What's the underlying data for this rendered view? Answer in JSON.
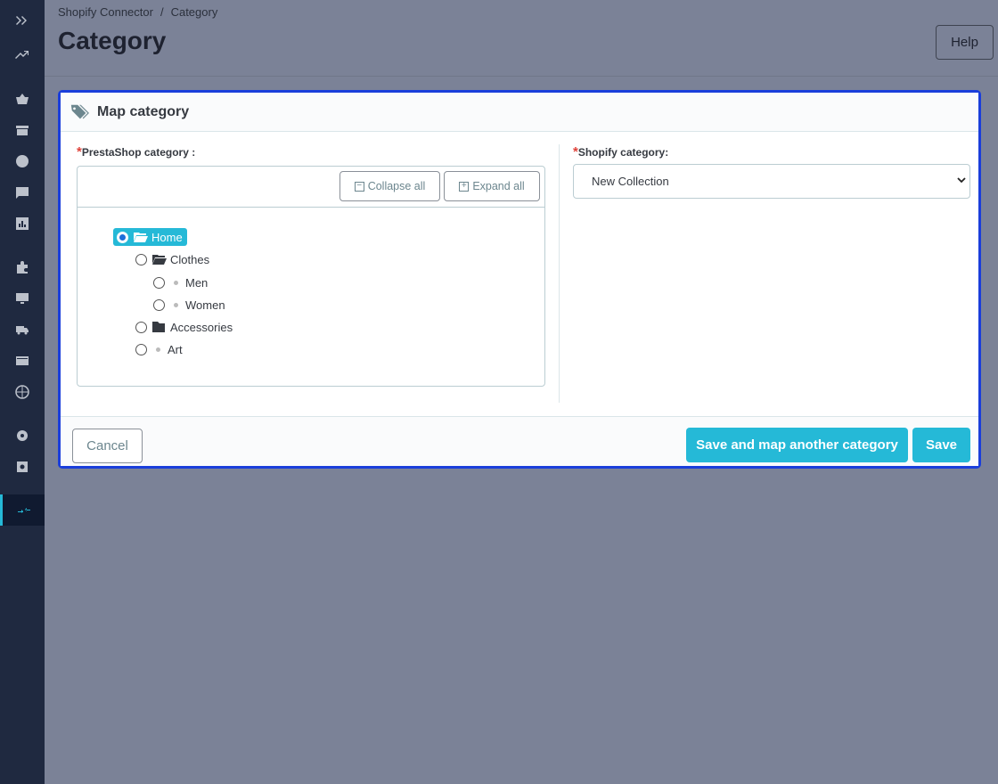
{
  "sidebar": {
    "icons": [
      "expand-icon",
      "stats-icon",
      "orders-icon",
      "catalog-icon",
      "customers-icon",
      "messages-icon",
      "reports-icon",
      "modules-icon",
      "design-icon",
      "shipping-icon",
      "payment-icon",
      "international-icon",
      "settings-icon",
      "advanced-icon",
      "shopify-connector-icon"
    ]
  },
  "breadcrumb": {
    "parent": "Shopify Connector",
    "separator": "/",
    "current": "Category"
  },
  "page": {
    "title": "Category",
    "help_label": "Help"
  },
  "card": {
    "title": "Map category",
    "prestashop_label": "PrestaShop category :",
    "shopify_label": "Shopify category:",
    "required_mark": "*",
    "collapse_all": "Collapse all",
    "expand_all": "Expand all",
    "tree": [
      {
        "label": "Home",
        "selected": true
      },
      {
        "label": "Clothes",
        "selected": false
      },
      {
        "label": "Men",
        "selected": false
      },
      {
        "label": "Women",
        "selected": false
      },
      {
        "label": "Accessories",
        "selected": false
      },
      {
        "label": "Art",
        "selected": false
      }
    ],
    "shopify_selected": "New Collection"
  },
  "footer": {
    "cancel": "Cancel",
    "save_and_map": "Save and map another category",
    "save": "Save"
  },
  "colors": {
    "accent": "#25b9d7",
    "sidebar": "#1f2940",
    "focus_border": "#1a3edb",
    "required": "#e0433a"
  }
}
